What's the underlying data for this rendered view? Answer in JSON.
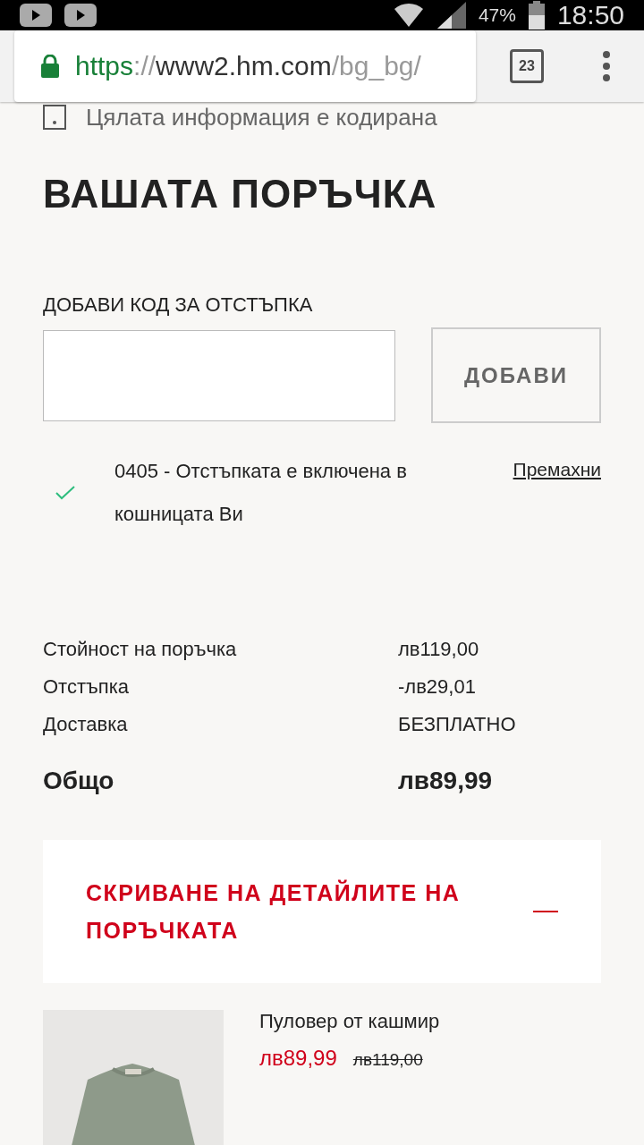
{
  "status_bar": {
    "battery": "47%",
    "time": "18:50"
  },
  "browser": {
    "url_scheme": "https",
    "url_sep": "://",
    "url_host": "www2.hm.com",
    "url_path": "/bg_bg/",
    "tabs_count": "23"
  },
  "security_note": "Цялата информация е кодирана",
  "title": "ВАШАТА ПОРЪЧКА",
  "discount": {
    "label": "ДОБАВИ КОД ЗА ОТСТЪПКА",
    "button": "ДОБАВИ",
    "applied": true,
    "message": "0405 - Отстъпката е включена в кошницата Ви",
    "remove_link": "Премахни"
  },
  "summary": [
    {
      "label": "Стойност на поръчка",
      "value": "лв119,00",
      "kind": "line"
    },
    {
      "label": "Отстъпка",
      "value": "-лв29,01",
      "kind": "line"
    },
    {
      "label": "Доставка",
      "value": "БЕЗПЛАТНО",
      "kind": "line"
    },
    {
      "label": "Общо",
      "value": "лв89,99",
      "kind": "total"
    }
  ],
  "details_toggle": {
    "label": "СКРИВАНЕ НА ДЕТАЙЛИТЕ НА ПОРЪЧКАТА",
    "expanded": true
  },
  "items": [
    {
      "name": "Пуловер от кашмир",
      "price": "лв89,99",
      "old_price": "лв119,00"
    }
  ]
}
